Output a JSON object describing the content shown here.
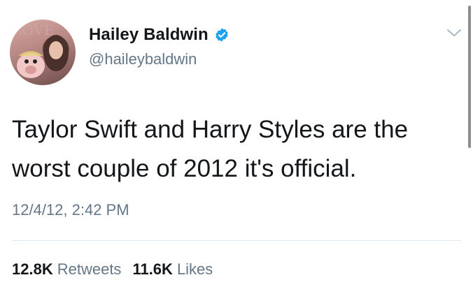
{
  "author": {
    "display_name": "Hailey Baldwin",
    "handle": "@haileybaldwin",
    "verified": true,
    "avatar_overlay_text": "LOVE"
  },
  "tweet": {
    "text": "Taylor Swift and Harry Styles are the worst couple of 2012 it's official.",
    "timestamp": "12/4/12, 2:42 PM"
  },
  "stats": {
    "retweets_count": "12.8K",
    "retweets_label": "Retweets",
    "likes_count": "11.6K",
    "likes_label": "Likes"
  },
  "colors": {
    "verified_badge": "#1da1f2",
    "secondary_text": "#657786",
    "primary_text": "#14171a",
    "divider": "#e1e8ed"
  },
  "icons": {
    "verified": "verified-badge-icon",
    "menu": "chevron-down-icon"
  }
}
